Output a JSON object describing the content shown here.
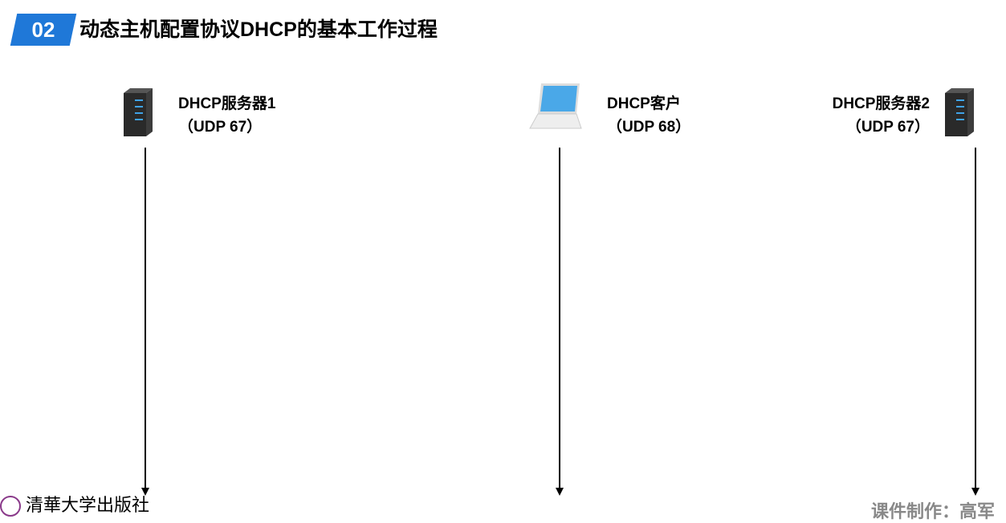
{
  "header": {
    "badge": "02",
    "title": "动态主机配置协议DHCP的基本工作过程"
  },
  "nodes": [
    {
      "name": "DHCP服务器1",
      "port": "（UDP 67）"
    },
    {
      "name": "DHCP客户",
      "port": "（UDP 68）"
    },
    {
      "name": "DHCP服务器2",
      "port": "（UDP 67）"
    }
  ],
  "footer": {
    "publisher": "清華大学出版社",
    "credit": "课件制作：高军"
  }
}
